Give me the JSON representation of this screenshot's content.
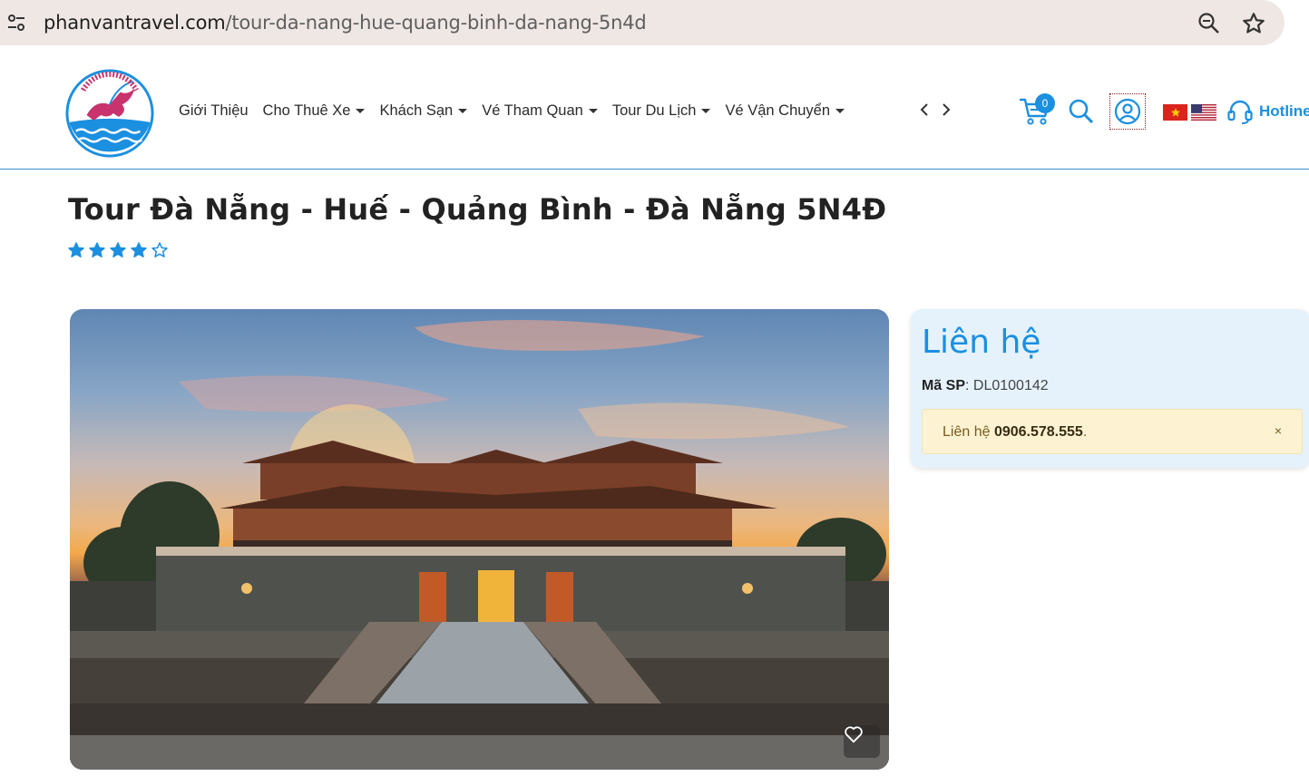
{
  "browser": {
    "url_domain": "phanvantravel.com",
    "url_path": "/tour-da-nang-hue-quang-binh-da-nang-5n4d"
  },
  "header": {
    "nav": [
      {
        "label": "Giới Thiệu",
        "dropdown": false
      },
      {
        "label": "Cho Thuê Xe",
        "dropdown": true
      },
      {
        "label": "Khách Sạn",
        "dropdown": true
      },
      {
        "label": "Vé Tham Quan",
        "dropdown": true
      },
      {
        "label": "Tour Du Lịch",
        "dropdown": true
      },
      {
        "label": "Vé Vận Chuyển",
        "dropdown": true
      }
    ],
    "cart_count": "0",
    "hotline_label": "Hotline"
  },
  "product": {
    "title": "Tour Đà Nẵng - Huế - Quảng Bình - Đà Nẵng 5N4Đ",
    "rating": 4,
    "rating_max": 5
  },
  "contact": {
    "heading": "Liên hệ",
    "sku_label": "Mã SP",
    "sku_value": "DL0100142",
    "alert_prefix": "Liên hệ ",
    "alert_phone": "0906.578.555",
    "alert_suffix": ".",
    "alert_close": "×"
  },
  "colors": {
    "brand_blue": "#1b8fe0",
    "alert_bg": "#fdf3d3",
    "panel_bg": "#e5f2fc"
  }
}
